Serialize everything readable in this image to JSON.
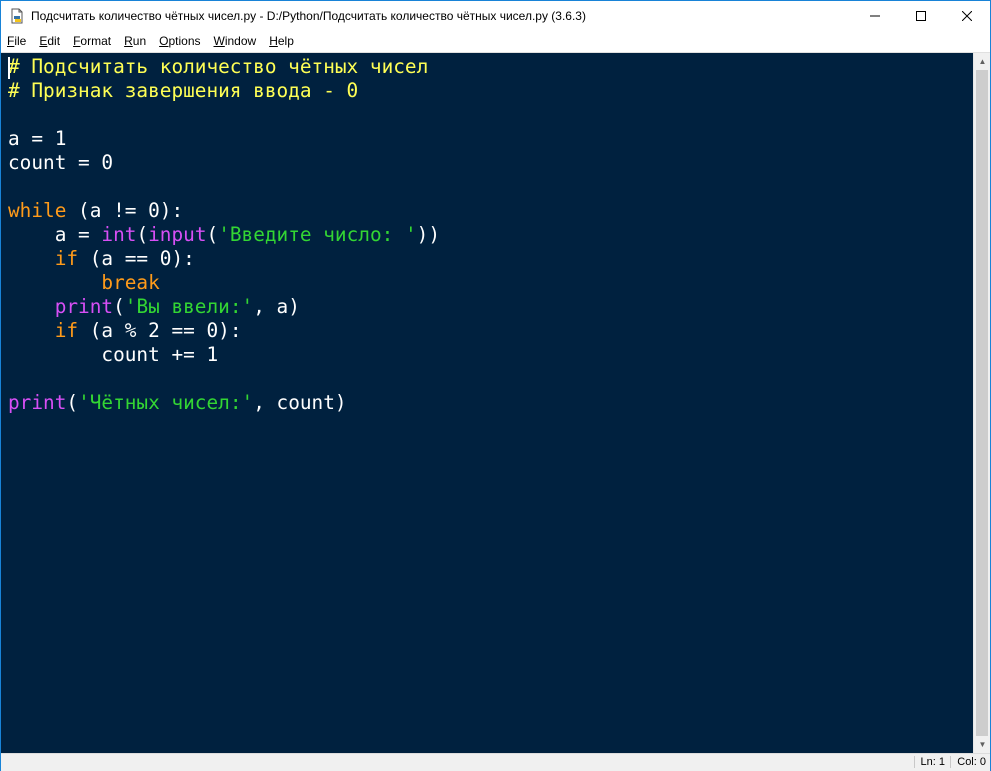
{
  "window": {
    "title": "Подсчитать количество чётных чисел.py - D:/Python/Подсчитать количество чётных чисел.py (3.6.3)",
    "controls": {
      "minimize": "—",
      "maximize": "☐",
      "close": "✕"
    }
  },
  "menu": [
    {
      "label": "File",
      "ul": "F",
      "rest": "ile"
    },
    {
      "label": "Edit",
      "ul": "E",
      "rest": "dit"
    },
    {
      "label": "Format",
      "ul": "F",
      "rest": "ormat",
      "pre": ""
    },
    {
      "label": "Run",
      "ul": "R",
      "rest": "un"
    },
    {
      "label": "Options",
      "ul": "O",
      "rest": "ptions"
    },
    {
      "label": "Window",
      "ul": "W",
      "rest": "indow"
    },
    {
      "label": "Help",
      "ul": "H",
      "rest": "elp"
    }
  ],
  "code_lines": [
    [
      {
        "t": "# Подсчитать количество чётных чисел",
        "c": "comment"
      }
    ],
    [
      {
        "t": "# Признак завершения ввода - 0",
        "c": "comment"
      }
    ],
    [],
    [
      {
        "t": "a = 1",
        "c": ""
      }
    ],
    [
      {
        "t": "count = 0",
        "c": ""
      }
    ],
    [],
    [
      {
        "t": "while",
        "c": "kw"
      },
      {
        "t": " (a != 0):",
        "c": ""
      }
    ],
    [
      {
        "t": "    a = ",
        "c": ""
      },
      {
        "t": "int",
        "c": "bi"
      },
      {
        "t": "(",
        "c": ""
      },
      {
        "t": "input",
        "c": "bi"
      },
      {
        "t": "(",
        "c": ""
      },
      {
        "t": "'Введите число: '",
        "c": "str"
      },
      {
        "t": "))",
        "c": ""
      }
    ],
    [
      {
        "t": "    ",
        "c": ""
      },
      {
        "t": "if",
        "c": "kw"
      },
      {
        "t": " (a == 0):",
        "c": ""
      }
    ],
    [
      {
        "t": "        ",
        "c": ""
      },
      {
        "t": "break",
        "c": "kw"
      }
    ],
    [
      {
        "t": "    ",
        "c": ""
      },
      {
        "t": "print",
        "c": "bi"
      },
      {
        "t": "(",
        "c": ""
      },
      {
        "t": "'Вы ввели:'",
        "c": "str"
      },
      {
        "t": ", a)",
        "c": ""
      }
    ],
    [
      {
        "t": "    ",
        "c": ""
      },
      {
        "t": "if",
        "c": "kw"
      },
      {
        "t": " (a % 2 == 0):",
        "c": ""
      }
    ],
    [
      {
        "t": "        count += 1",
        "c": ""
      }
    ],
    [],
    [
      {
        "t": "print",
        "c": "bi"
      },
      {
        "t": "(",
        "c": ""
      },
      {
        "t": "'Чётных чисел:'",
        "c": "str"
      },
      {
        "t": ", count)",
        "c": ""
      }
    ]
  ],
  "status": {
    "line": "Ln: 1",
    "col": "Col: 0"
  },
  "colors": {
    "editor_bg": "#00213f",
    "comment": "#ffff55",
    "keyword": "#ff9b1a",
    "builtin": "#d74ff5",
    "string": "#33d633",
    "default": "#ffffff"
  },
  "icons": {
    "app": "python-idle-icon"
  }
}
